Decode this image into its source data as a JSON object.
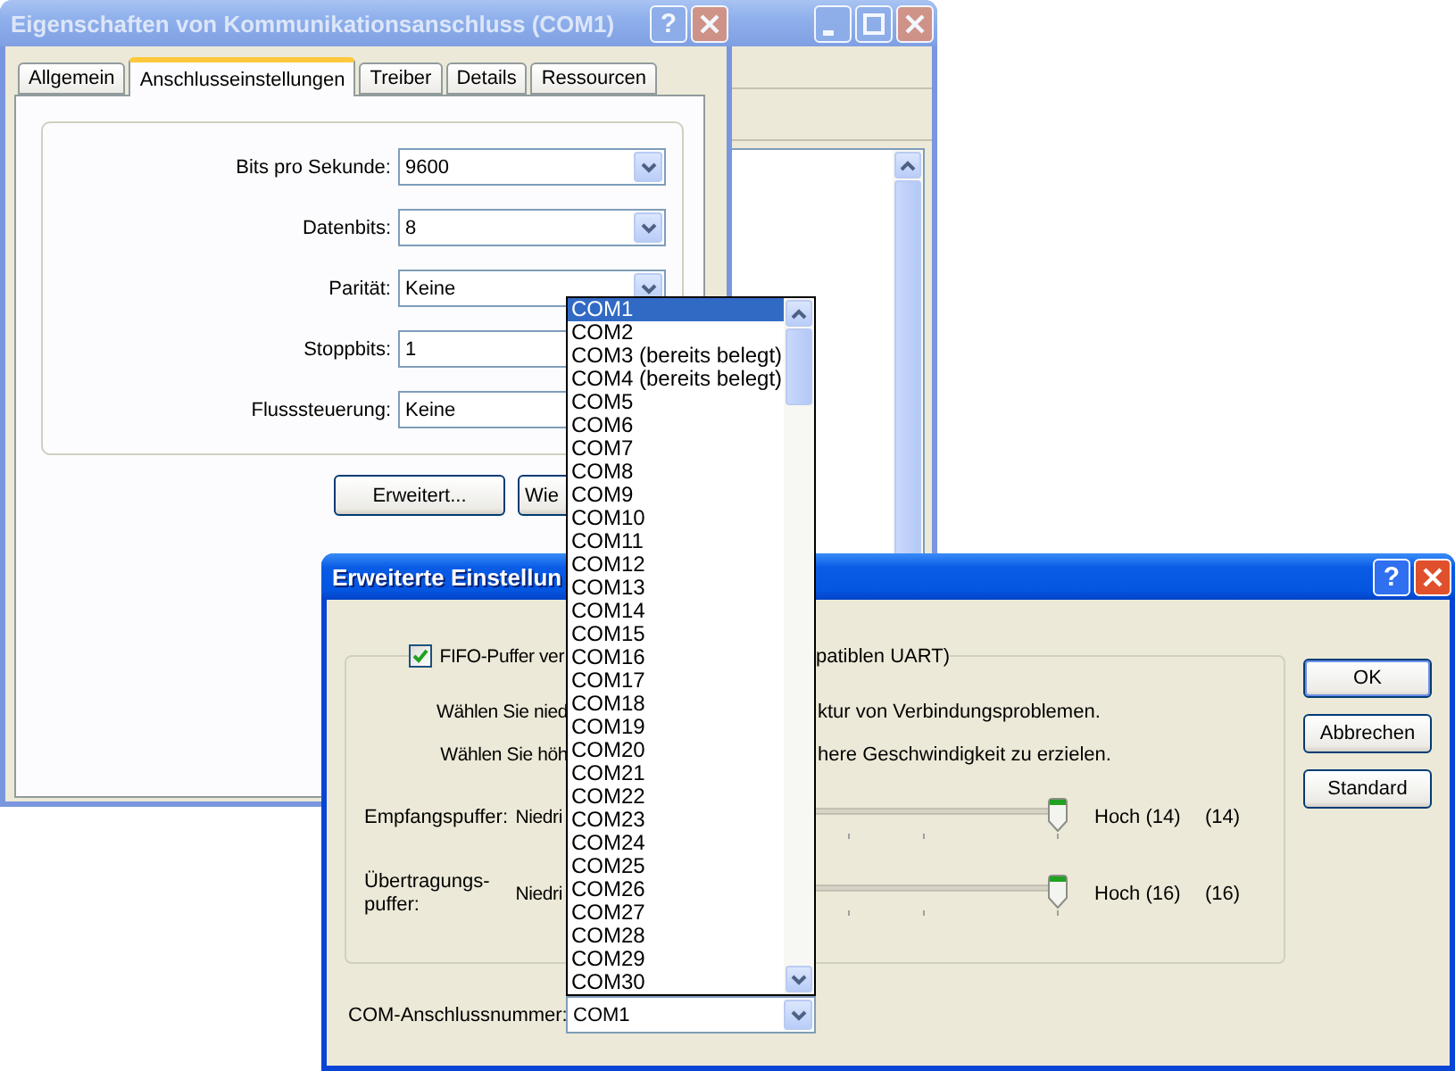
{
  "properties_dialog": {
    "title": "Eigenschaften von Kommunikationsanschluss (COM1)",
    "active": false,
    "help": "?",
    "tabs": [
      {
        "label": "Allgemein",
        "selected": false
      },
      {
        "label": "Anschlusseinstellungen",
        "selected": true
      },
      {
        "label": "Treiber",
        "selected": false
      },
      {
        "label": "Details",
        "selected": false
      },
      {
        "label": "Ressourcen",
        "selected": false
      }
    ],
    "fields": [
      {
        "label": "Bits pro Sekunde:",
        "value": "9600",
        "kind": "dropdown"
      },
      {
        "label": "Datenbits:",
        "value": "8",
        "kind": "dropdown"
      },
      {
        "label": "Parität:",
        "value": "Keine",
        "kind": "dropdown"
      },
      {
        "label": "Stoppbits:",
        "value": "1",
        "kind": "covered"
      },
      {
        "label": "Flusssteuerung:",
        "value": "Keine",
        "kind": "covered"
      }
    ],
    "buttons": [
      "Erweitert...",
      "Wie"
    ]
  },
  "advanced_dialog": {
    "title": "Erweiterte Einstellun",
    "active": true,
    "help": "?",
    "fifo": {
      "checked": true,
      "label_start": "FIFO-Puffer ver",
      "label_end": "patiblen UART)"
    },
    "hints": [
      {
        "start": "Wählen Sie nied",
        "end": "ktur von Verbindungsproblemen."
      },
      {
        "start": "Wählen Sie höh",
        "end": "here Geschwindigkeit zu erzielen."
      }
    ],
    "buffers": [
      {
        "label": "Empfangspuffer:",
        "low": "Niedri",
        "level": 1,
        "high": "Hoch (14)",
        "value": "(14)"
      },
      {
        "label": "Übertragungs-puffer:",
        "low": "Niedri",
        "level": 1,
        "high": "Hoch (16)",
        "value": "(16)"
      }
    ],
    "port": {
      "label": "COM-Anschlussnummer:",
      "value": "COM1"
    },
    "buttons": [
      {
        "label": "OK",
        "default": true
      },
      {
        "label": "Abbrechen",
        "default": false
      },
      {
        "label": "Standard",
        "default": false
      }
    ]
  },
  "port_list": {
    "items": [
      {
        "label": "COM1",
        "selected": true
      },
      {
        "label": "COM2",
        "selected": false
      },
      {
        "label": "COM3 (bereits belegt)",
        "selected": false
      },
      {
        "label": "COM4 (bereits belegt)",
        "selected": false
      },
      {
        "label": "COM5",
        "selected": false
      },
      {
        "label": "COM6",
        "selected": false
      },
      {
        "label": "COM7",
        "selected": false
      },
      {
        "label": "COM8",
        "selected": false
      },
      {
        "label": "COM9",
        "selected": false
      },
      {
        "label": "COM10",
        "selected": false
      },
      {
        "label": "COM11",
        "selected": false
      },
      {
        "label": "COM12",
        "selected": false
      },
      {
        "label": "COM13",
        "selected": false
      },
      {
        "label": "COM14",
        "selected": false
      },
      {
        "label": "COM15",
        "selected": false
      },
      {
        "label": "COM16",
        "selected": false
      },
      {
        "label": "COM17",
        "selected": false
      },
      {
        "label": "COM18",
        "selected": false
      },
      {
        "label": "COM19",
        "selected": false
      },
      {
        "label": "COM20",
        "selected": false
      },
      {
        "label": "COM21",
        "selected": false
      },
      {
        "label": "COM22",
        "selected": false
      },
      {
        "label": "COM23",
        "selected": false
      },
      {
        "label": "COM24",
        "selected": false
      },
      {
        "label": "COM25",
        "selected": false
      },
      {
        "label": "COM26",
        "selected": false
      },
      {
        "label": "COM27",
        "selected": false
      },
      {
        "label": "COM28",
        "selected": false
      },
      {
        "label": "COM29",
        "selected": false
      },
      {
        "label": "COM30",
        "selected": false
      }
    ]
  }
}
